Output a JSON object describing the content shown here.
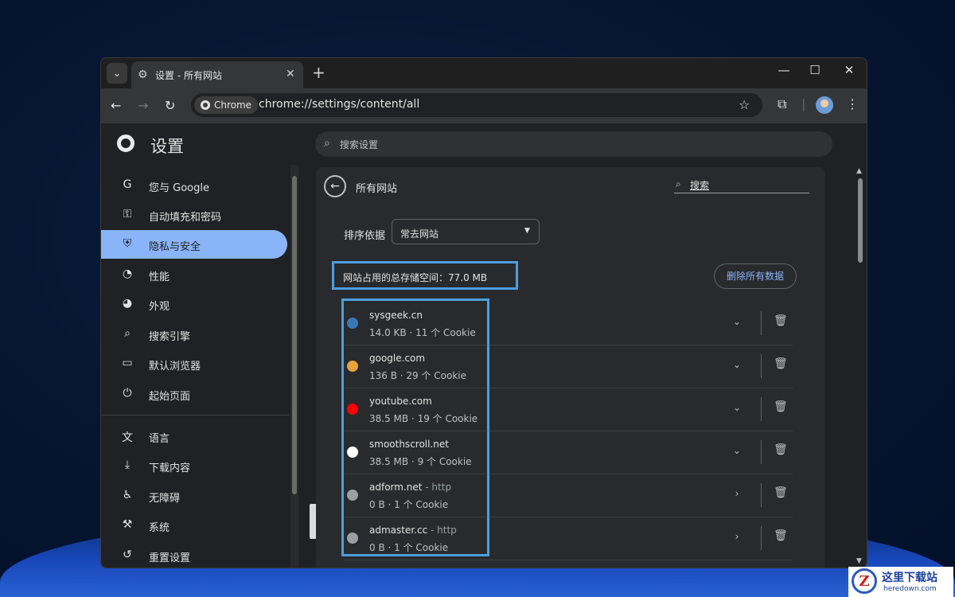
{
  "tab": {
    "title": "设置 - 所有网站",
    "close": "✕",
    "new": "+",
    "search_arrow": "⌄"
  },
  "window_controls": {
    "minimize": "—",
    "maximize": "☐",
    "close": "✕"
  },
  "toolbar": {
    "back": "←",
    "forward": "→",
    "reload": "↻",
    "chip_label": "Chrome",
    "url": "chrome://settings/content/all",
    "star": "☆",
    "extensions": "⧉",
    "menu": "⋮"
  },
  "settings": {
    "title": "设置",
    "search_placeholder": "搜索设置"
  },
  "sidebar": {
    "items": [
      {
        "icon": "G",
        "label": "您与 Google"
      },
      {
        "icon": "⚿",
        "label": "自动填充和密码"
      },
      {
        "icon": "⛨",
        "label": "隐私与安全"
      },
      {
        "icon": "◔",
        "label": "性能"
      },
      {
        "icon": "◕",
        "label": "外观"
      },
      {
        "icon": "⌕",
        "label": "搜索引擎"
      },
      {
        "icon": "▭",
        "label": "默认浏览器"
      },
      {
        "icon": "⏻",
        "label": "起始页面"
      },
      {
        "icon": "文",
        "label": "语言"
      },
      {
        "icon": "⤓",
        "label": "下载内容"
      },
      {
        "icon": "♿",
        "label": "无障碍"
      },
      {
        "icon": "⚒",
        "label": "系统"
      },
      {
        "icon": "↺",
        "label": "重置设置"
      }
    ],
    "active_index": 2
  },
  "main": {
    "title": "所有网站",
    "search_label": "搜索",
    "sort_label": "排序依据",
    "sort_value": "常去网站",
    "storage_text": "网站占用的总存储空间：77.0 MB",
    "delete_all": "删除所有数据",
    "sites": [
      {
        "name": "sysgeek.cn",
        "suffix": "",
        "info": "14.0 KB · 11 个 Cookie",
        "expand": "⌄",
        "favicon_color": "#3a78b5"
      },
      {
        "name": "google.com",
        "suffix": "",
        "info": "136 B · 29 个 Cookie",
        "expand": "⌄",
        "favicon_color": "#e8a33d"
      },
      {
        "name": "youtube.com",
        "suffix": "",
        "info": "38.5 MB · 19 个 Cookie",
        "expand": "⌄",
        "favicon_color": "#ff0000"
      },
      {
        "name": "smoothscroll.net",
        "suffix": "",
        "info": "38.5 MB · 9 个 Cookie",
        "expand": "⌄",
        "favicon_color": "#ffffff"
      },
      {
        "name": "adform.net",
        "suffix": " - http",
        "info": "0 B · 1 个 Cookie",
        "expand": "›",
        "favicon_color": "#9aa0a6"
      },
      {
        "name": "admaster.cc",
        "suffix": " - http",
        "info": "0 B · 1 个 Cookie",
        "expand": "›",
        "favicon_color": "#9aa0a6"
      }
    ]
  },
  "watermark": {
    "mark": "Z",
    "title": "这里下载站",
    "url": "heredown.com"
  }
}
